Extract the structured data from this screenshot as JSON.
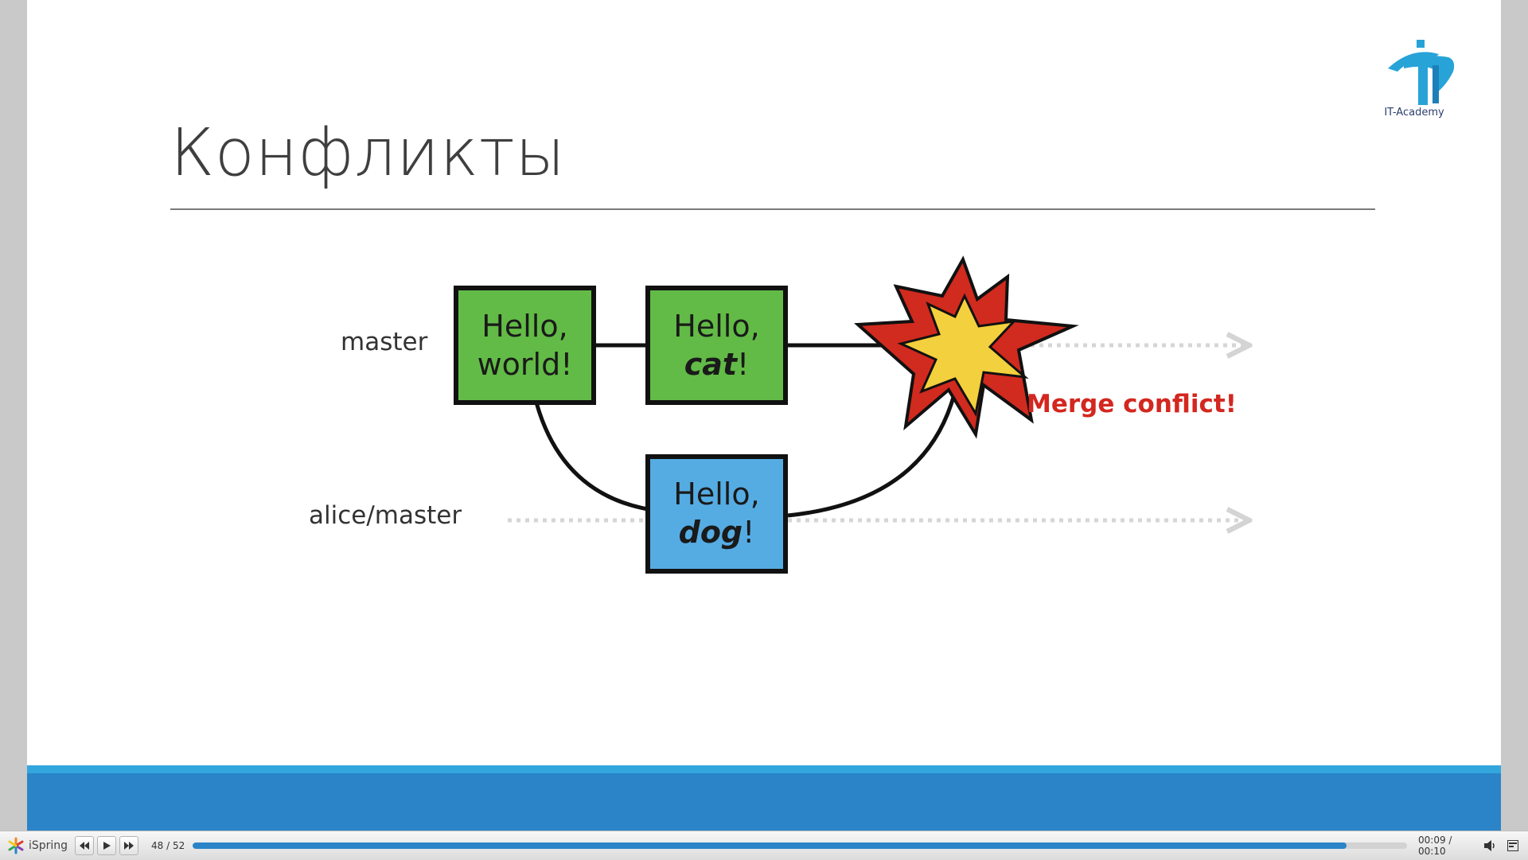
{
  "slide": {
    "title": "Конфликты",
    "logo_text": "IT-Academy",
    "diagram": {
      "branch_master": "master",
      "branch_alice": "alice/master",
      "node1": {
        "line1": "Hello,",
        "line2": "world!"
      },
      "node2": {
        "line1": "Hello,",
        "word": "cat",
        "punct": "!"
      },
      "node3": {
        "line1": "Hello,",
        "word": "dog",
        "punct": "!"
      },
      "conflict_label": "Merge conflict!"
    },
    "colors": {
      "green_node": "#62bb46",
      "blue_node": "#55ace3",
      "star_red": "#d12a1e",
      "star_yellow": "#f3d03d",
      "conflict_text": "#d3271f",
      "band": "#2a84c7"
    }
  },
  "player": {
    "brand": "iSpring",
    "slide_counter": "48 / 52",
    "progress": 0.95,
    "time": "00:09 / 00:10",
    "icons": [
      "prev-icon",
      "play-icon",
      "next-icon",
      "volume-icon",
      "menu-icon"
    ]
  }
}
